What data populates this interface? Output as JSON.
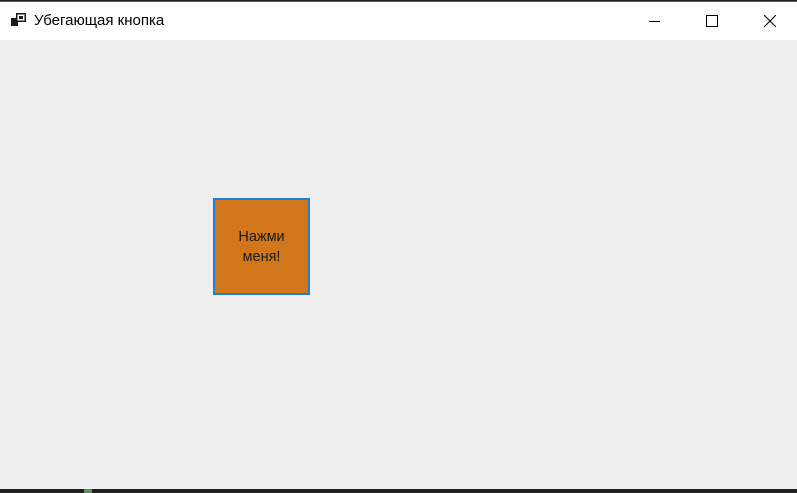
{
  "window": {
    "title": "Убегающая кнопка",
    "app_icon": "form-icon",
    "controls": {
      "minimize_icon": "minimize-icon",
      "maximize_icon": "maximize-icon",
      "close_icon": "close-icon"
    }
  },
  "client": {
    "button": {
      "label": "Нажми\nменя!",
      "background_color": "#d2761c",
      "focus_border_color": "#1e7fd6"
    }
  }
}
